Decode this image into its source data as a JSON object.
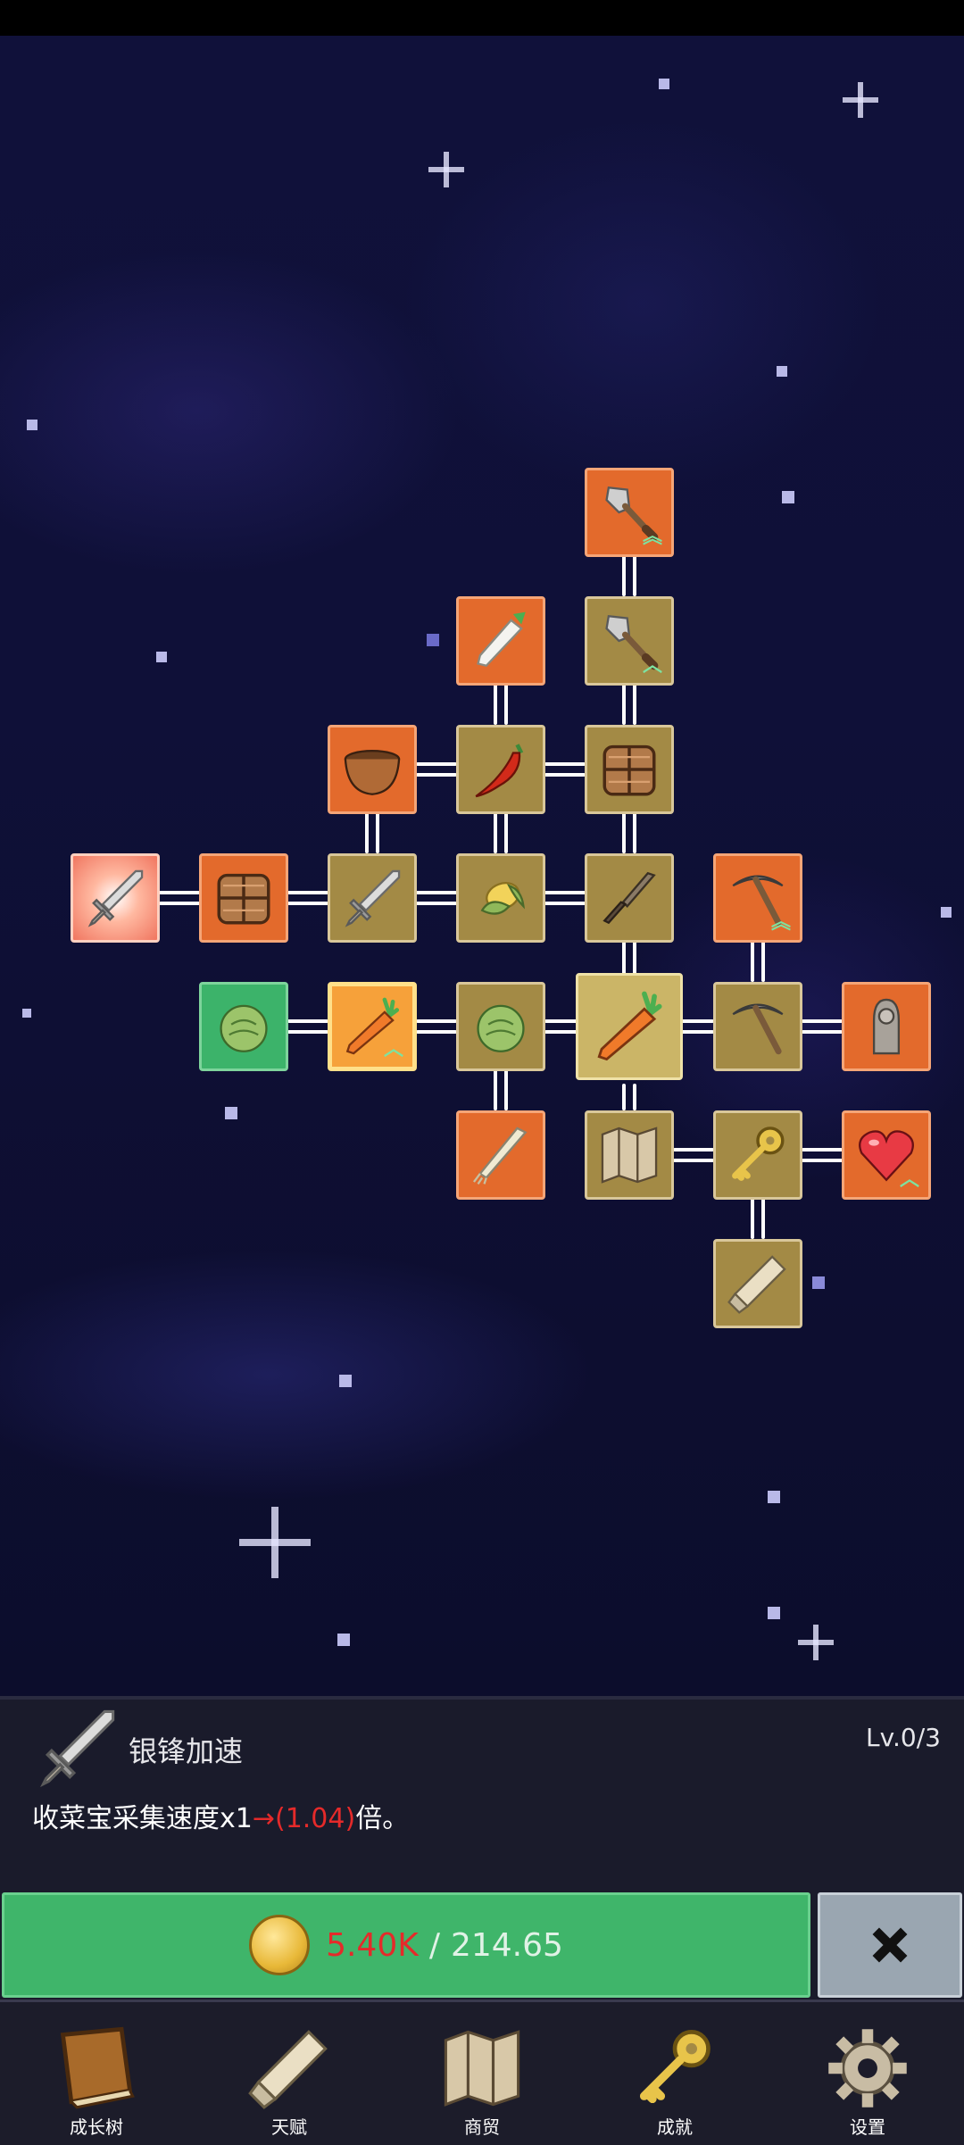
{
  "skill_tree": {
    "nodes": [
      {
        "id": "shovel-top",
        "icon": "shovel-icon",
        "style": "orange",
        "upgrade": true
      },
      {
        "id": "radish",
        "icon": "radish-icon",
        "style": "orange",
        "upgrade": false
      },
      {
        "id": "shovel",
        "icon": "shovel-icon",
        "style": "gold",
        "upgrade": true
      },
      {
        "id": "bowl",
        "icon": "bowl-icon",
        "style": "orange",
        "upgrade": false
      },
      {
        "id": "chili",
        "icon": "chili-pepper-icon",
        "style": "gold",
        "upgrade": false
      },
      {
        "id": "basket-top",
        "icon": "basket-icon",
        "style": "gold",
        "upgrade": false
      },
      {
        "id": "silver-sword",
        "icon": "sword-icon",
        "style": "highlighted",
        "upgrade": false
      },
      {
        "id": "basket-left",
        "icon": "basket-icon",
        "style": "orange",
        "upgrade": false
      },
      {
        "id": "sword",
        "icon": "sword-icon",
        "style": "gold",
        "upgrade": false
      },
      {
        "id": "corn",
        "icon": "corn-icon",
        "style": "gold",
        "upgrade": false
      },
      {
        "id": "dagger",
        "icon": "dagger-icon",
        "style": "gold",
        "upgrade": false
      },
      {
        "id": "pickaxe-top",
        "icon": "pickaxe-icon",
        "style": "orange",
        "upgrade": true
      },
      {
        "id": "cabbage-green",
        "icon": "cabbage-icon",
        "style": "green",
        "upgrade": false
      },
      {
        "id": "carrot-selected",
        "icon": "carrot-icon",
        "style": "selected",
        "upgrade": true
      },
      {
        "id": "cabbage",
        "icon": "cabbage-icon",
        "style": "gold",
        "upgrade": false
      },
      {
        "id": "carrot-center",
        "icon": "carrot-icon",
        "style": "center",
        "upgrade": false
      },
      {
        "id": "pickaxe",
        "icon": "pickaxe-icon",
        "style": "gold",
        "upgrade": false
      },
      {
        "id": "statue",
        "icon": "statue-icon",
        "style": "orange",
        "upgrade": false
      },
      {
        "id": "leek",
        "icon": "leek-icon",
        "style": "orange",
        "upgrade": false
      },
      {
        "id": "map",
        "icon": "map-icon",
        "style": "gold",
        "upgrade": false
      },
      {
        "id": "key",
        "icon": "key-icon",
        "style": "gold",
        "upgrade": false
      },
      {
        "id": "heart",
        "icon": "heart-icon",
        "style": "orange",
        "upgrade": true
      },
      {
        "id": "scroll",
        "icon": "scroll-icon",
        "style": "gold",
        "upgrade": false
      }
    ]
  },
  "detail": {
    "icon": "sword-icon",
    "name": "银锋加速",
    "level": "Lv.0/3",
    "desc_prefix": "收菜宝采集速度x1",
    "desc_arrow": "→",
    "desc_value": "(1.04)",
    "desc_suffix": "倍。"
  },
  "purchase": {
    "icon": "coin-icon",
    "cost": "5.40K",
    "separator": "/",
    "balance": "214.65",
    "close_icon": "close-icon"
  },
  "nav": [
    {
      "label": "成长树",
      "icon": "book-icon"
    },
    {
      "label": "天赋",
      "icon": "scroll-icon"
    },
    {
      "label": "商贸",
      "icon": "map-icon"
    },
    {
      "label": "成就",
      "icon": "key-icon"
    },
    {
      "label": "设置",
      "icon": "gear-icon"
    }
  ],
  "colors": {
    "background": "#0d0d26",
    "node_gold": "#a38a45",
    "node_orange": "#e36a2c",
    "node_green": "#3cb36a",
    "buy_button": "#3fb56a",
    "close_button": "#9aa6b1",
    "cost_red": "#e52a2a"
  }
}
